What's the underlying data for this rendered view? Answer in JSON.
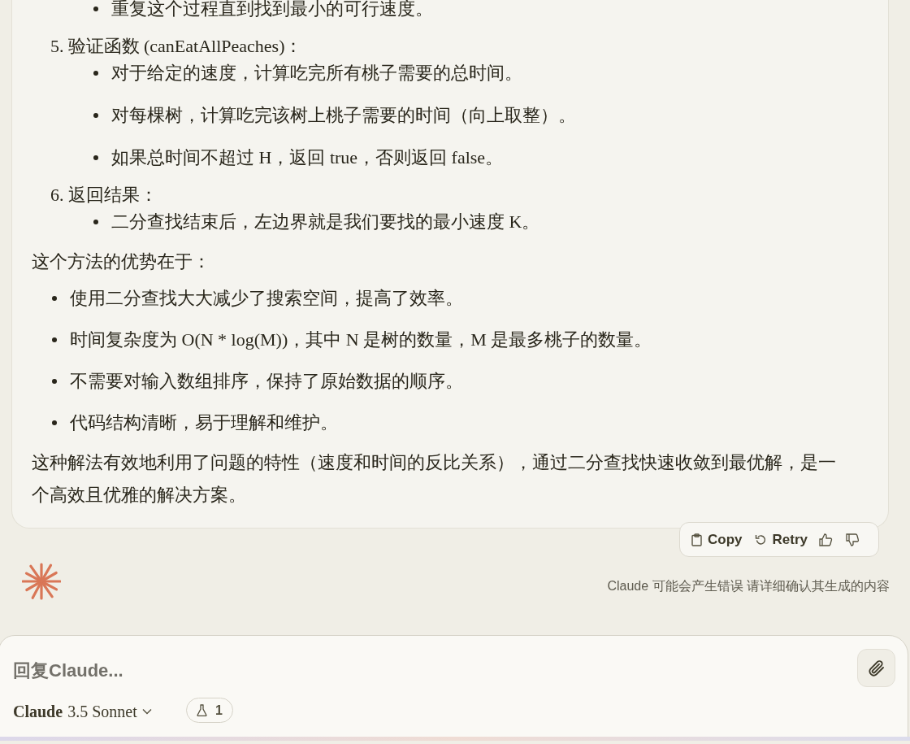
{
  "message": {
    "blocks": [
      {
        "kind": "bullet-continuation",
        "items": [
          "重复这个过程直到找到最小的可行速度。"
        ]
      },
      {
        "kind": "numbered",
        "number": "5.",
        "text": "验证函数 (canEatAllPeaches)：",
        "items": [
          "对于给定的速度，计算吃完所有桃子需要的总时间。",
          "对每棵树，计算吃完该树上桃子需要的时间（向上取整）。",
          "如果总时间不超过 H，返回 true，否则返回 false。"
        ]
      },
      {
        "kind": "numbered",
        "number": "6.",
        "text": "返回结果：",
        "items": [
          "二分查找结束后，左边界就是我们要找的最小速度 K。"
        ]
      },
      {
        "kind": "paragraph",
        "text": "这个方法的优势在于："
      },
      {
        "kind": "list",
        "items": [
          "使用二分查找大大减少了搜索空间，提高了效率。",
          "时间复杂度为 O(N * log(M))，其中 N 是树的数量，M 是最多桃子的数量。",
          "不需要对输入数组排序，保持了原始数据的顺序。",
          "代码结构清晰，易于理解和维护。"
        ]
      },
      {
        "kind": "paragraph",
        "text": "这种解法有效地利用了问题的特性（速度和时间的反比关系），通过二分查找快速收敛到最优解，是一个高效且优雅的解决方案。"
      }
    ],
    "actions": {
      "copy": "Copy",
      "retry": "Retry"
    }
  },
  "disclaimer": "Claude 可能会产生错误 请详细确认其生成的内容",
  "composer": {
    "placeholder": "回复Claude...",
    "model_name": "Claude",
    "model_version": "3.5 Sonnet",
    "badge_count": "1"
  }
}
